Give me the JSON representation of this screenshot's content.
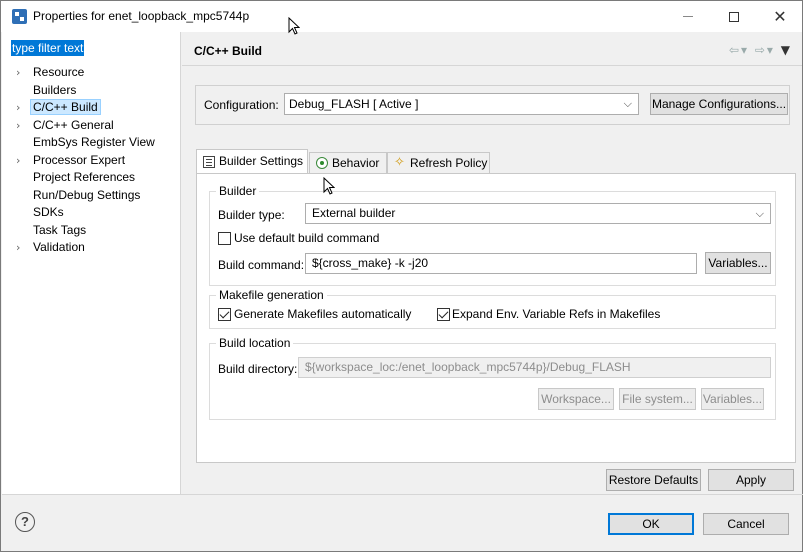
{
  "window": {
    "title": "Properties for enet_loopback_mpc5744p",
    "minimize_glyph": "",
    "maximize_glyph": "",
    "close_glyph": "✕"
  },
  "sidebar": {
    "filter_text": "type filter text",
    "items": [
      {
        "label": "Resource",
        "expandable": true
      },
      {
        "label": "Builders",
        "expandable": false
      },
      {
        "label": "C/C++ Build",
        "expandable": true,
        "selected": true
      },
      {
        "label": "C/C++ General",
        "expandable": true
      },
      {
        "label": "EmbSys Register View",
        "expandable": false
      },
      {
        "label": "Processor Expert",
        "expandable": true
      },
      {
        "label": "Project References",
        "expandable": false
      },
      {
        "label": "Run/Debug Settings",
        "expandable": false
      },
      {
        "label": "SDKs",
        "expandable": false
      },
      {
        "label": "Task Tags",
        "expandable": false
      },
      {
        "label": "Validation",
        "expandable": true
      }
    ]
  },
  "header": {
    "title": "C/C++ Build",
    "back_icon": "back-arrow-icon",
    "forward_icon": "forward-arrow-icon"
  },
  "configuration": {
    "label": "Configuration:",
    "value": "Debug_FLASH  [ Active ]",
    "manage_label": "Manage Configurations..."
  },
  "tabs": [
    {
      "label": "Builder Settings",
      "icon": "document-icon",
      "active": true
    },
    {
      "label": "Behavior",
      "icon": "radio-icon",
      "active": false
    },
    {
      "label": "Refresh Policy",
      "icon": "refresh-icon",
      "active": false
    }
  ],
  "builder": {
    "group_label": "Builder",
    "type_label": "Builder type:",
    "type_value": "External builder",
    "use_default_label": "Use default build command",
    "use_default_checked": false,
    "command_label": "Build command:",
    "command_value": "${cross_make} -k -j20",
    "variables_label": "Variables..."
  },
  "makefile": {
    "group_label": "Makefile generation",
    "generate_label": "Generate Makefiles automatically",
    "generate_checked": true,
    "expand_label": "Expand Env. Variable Refs in Makefiles",
    "expand_checked": true
  },
  "location": {
    "group_label": "Build location",
    "directory_label": "Build directory:",
    "directory_value": "${workspace_loc:/enet_loopback_mpc5744p}/Debug_FLASH",
    "workspace_label": "Workspace...",
    "filesystem_label": "File system...",
    "variables_label": "Variables..."
  },
  "page_buttons": {
    "restore_label": "Restore Defaults",
    "apply_label": "Apply"
  },
  "dialog_buttons": {
    "help_glyph": "?",
    "ok_label": "OK",
    "cancel_label": "Cancel"
  },
  "colors": {
    "selection": "#0078d7",
    "tree_selection": "#cce8ff",
    "default_button_border": "#0078d7"
  }
}
